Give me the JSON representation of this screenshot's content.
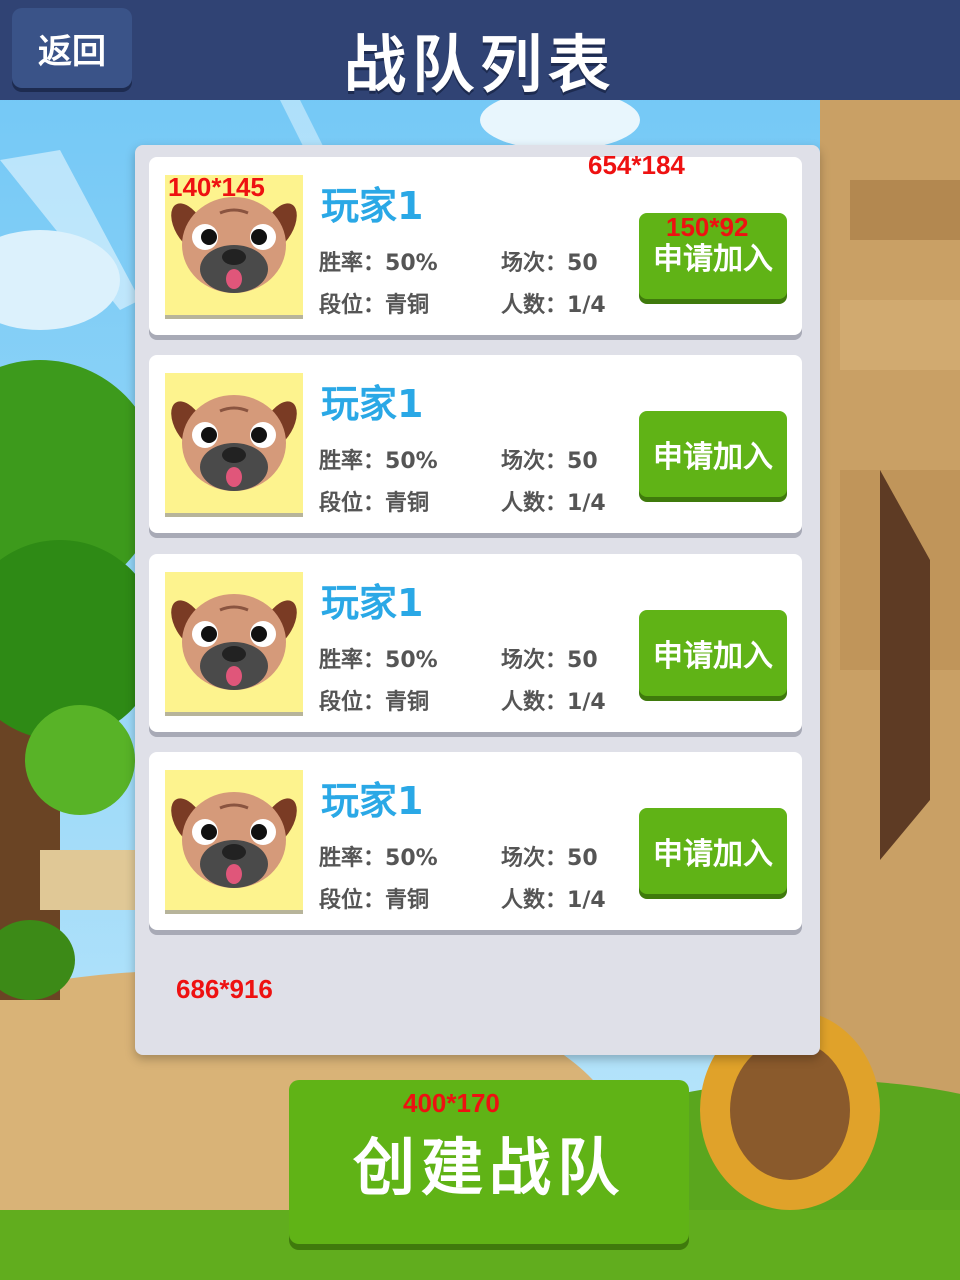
{
  "header": {
    "back_label": "返回",
    "title": "战队列表"
  },
  "teams": [
    {
      "name": "玩家1",
      "win_rate_label": "胜率：",
      "win_rate": "50%",
      "matches_label": "场次：",
      "matches": "50",
      "rank_label": "段位：",
      "rank": "青铜",
      "members_label": "人数：",
      "members": "1/4",
      "join_label": "申请加入"
    },
    {
      "name": "玩家1",
      "win_rate_label": "胜率：",
      "win_rate": "50%",
      "matches_label": "场次：",
      "matches": "50",
      "rank_label": "段位：",
      "rank": "青铜",
      "members_label": "人数：",
      "members": "1/4",
      "join_label": "申请加入"
    },
    {
      "name": "玩家1",
      "win_rate_label": "胜率：",
      "win_rate": "50%",
      "matches_label": "场次：",
      "matches": "50",
      "rank_label": "段位：",
      "rank": "青铜",
      "members_label": "人数：",
      "members": "1/4",
      "join_label": "申请加入"
    },
    {
      "name": "玩家1",
      "win_rate_label": "胜率：",
      "win_rate": "50%",
      "matches_label": "场次：",
      "matches": "50",
      "rank_label": "段位：",
      "rank": "青铜",
      "members_label": "人数：",
      "members": "1/4",
      "join_label": "申请加入"
    }
  ],
  "annotations": {
    "avatar_size": "140*145",
    "card_size": "654*184",
    "join_button_size": "150*92",
    "panel_size": "686*916",
    "create_button_size": "400*170"
  },
  "create_button_label": "创建战队",
  "colors": {
    "header": "#304374",
    "green_button": "#60b316",
    "player_name": "#2aa8e6",
    "avatar_bg": "#fdf38e",
    "annotation": "#ee1111"
  }
}
